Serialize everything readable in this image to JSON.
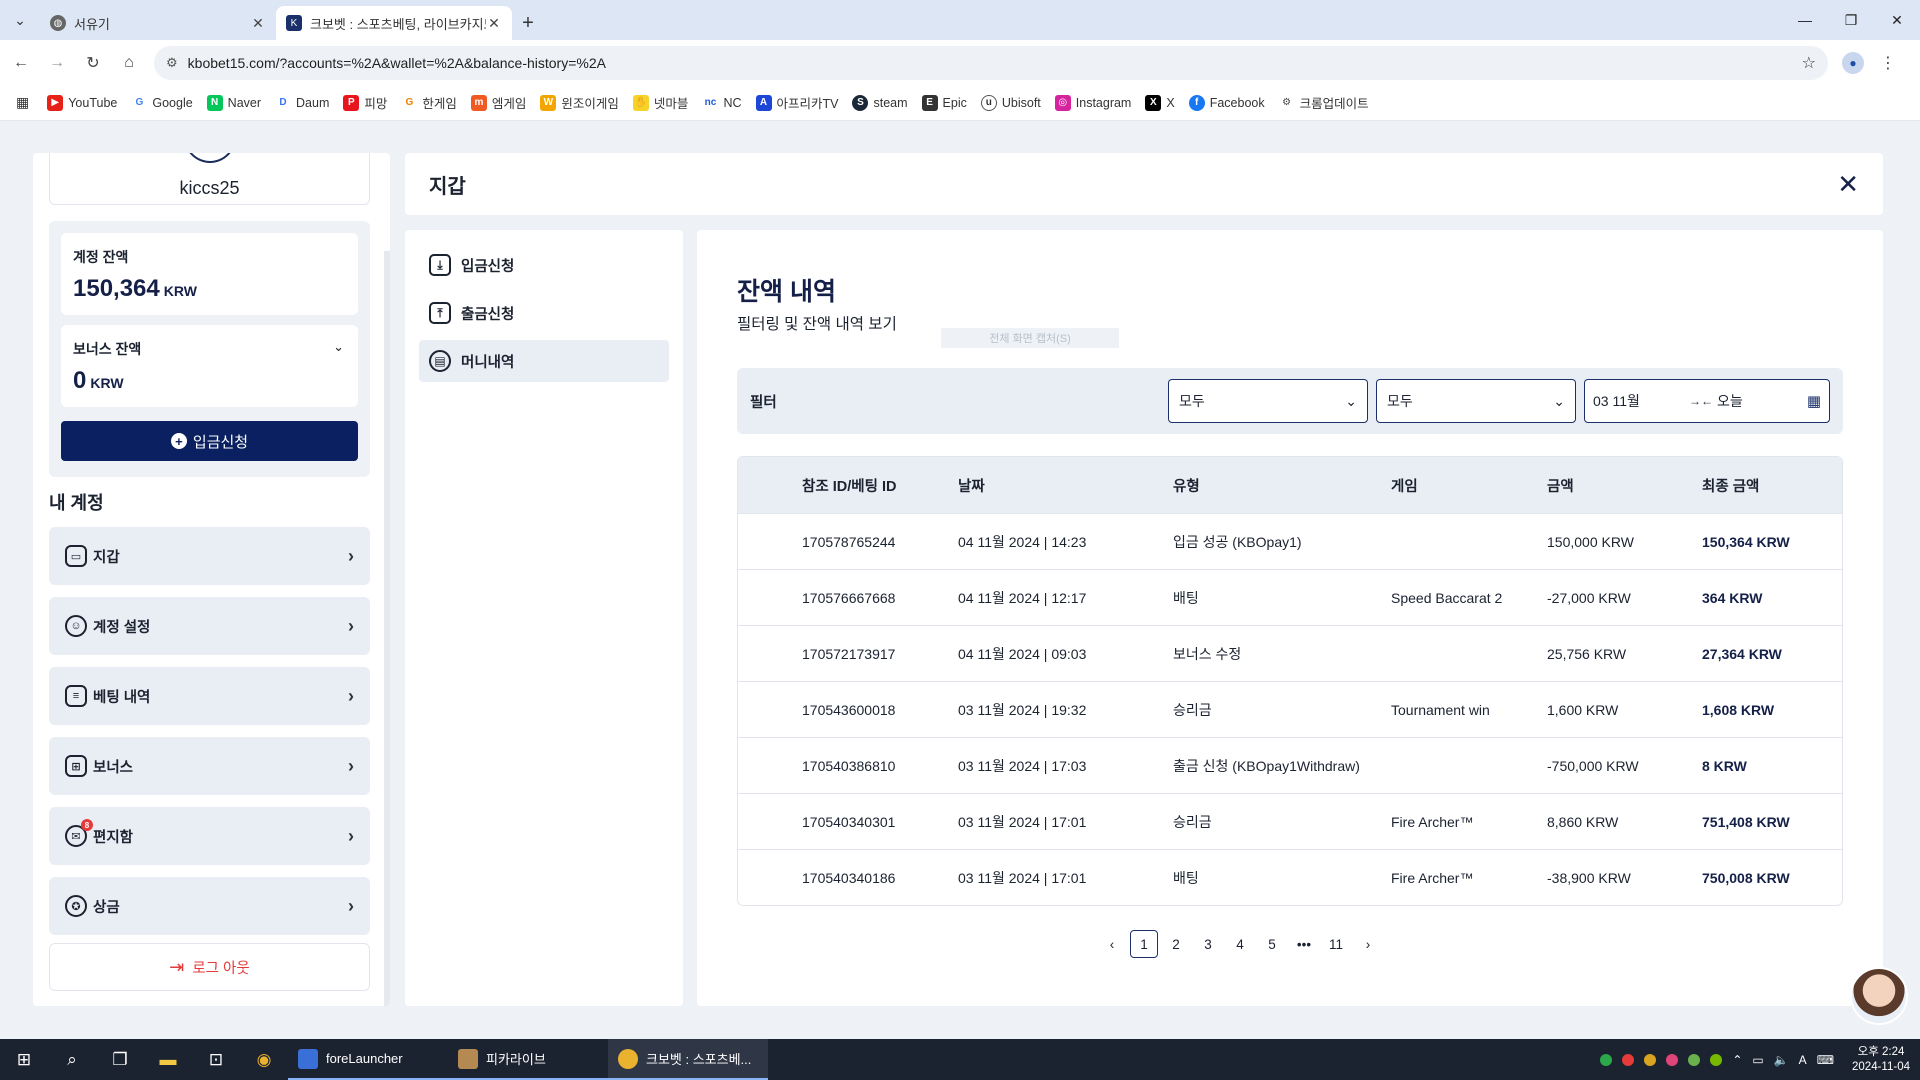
{
  "browser": {
    "tabs": [
      {
        "title": "서유기",
        "active": false
      },
      {
        "title": "크보벳 : 스포츠베팅, 라이브카지노",
        "active": true
      }
    ],
    "url": "kbobet15.com/?accounts=%2A&wallet=%2A&balance-history=%2A",
    "bookmarks": [
      "YouTube",
      "Google",
      "Naver",
      "Daum",
      "피망",
      "한게임",
      "엠게임",
      "윈조이게임",
      "넷마블",
      "NC",
      "아프리카TV",
      "steam",
      "Epic",
      "Ubisoft",
      "Instagram",
      "X",
      "Facebook",
      "크롬업데이트"
    ]
  },
  "sidebar": {
    "username": "kiccs25",
    "account_balance_label": "계정 잔액",
    "account_balance": "150,364",
    "bonus_balance_label": "보너스 잔액",
    "bonus_balance": "0",
    "currency": "KRW",
    "deposit_button": "입금신청",
    "my_account_title": "내 계정",
    "menu": [
      {
        "label": "지갑",
        "icon": "wallet-icon"
      },
      {
        "label": "계정 설정",
        "icon": "user-settings-icon"
      },
      {
        "label": "베팅 내역",
        "icon": "bet-history-icon"
      },
      {
        "label": "보너스",
        "icon": "gift-icon"
      },
      {
        "label": "편지함",
        "icon": "mailbox-icon",
        "badge": "8"
      },
      {
        "label": "상금",
        "icon": "prize-icon"
      }
    ],
    "logout": "로그 아웃"
  },
  "wallet": {
    "title": "지갑",
    "submenu": [
      {
        "label": "입금신청",
        "icon": "download-icon"
      },
      {
        "label": "출금신청",
        "icon": "upload-icon"
      },
      {
        "label": "머니내역",
        "icon": "document-icon"
      }
    ]
  },
  "balance_history": {
    "title": "잔액 내역",
    "subtitle": "필터링 및 잔액 내역 보기",
    "ghost_text": "전체 화면 캡처(S)",
    "filter_label": "필터",
    "filter_select_1": "모두",
    "filter_select_2": "모두",
    "date_from": "03 11월",
    "date_to": "오늘",
    "columns": [
      "참조 ID/베팅 ID",
      "날짜",
      "유형",
      "게임",
      "금액",
      "최종 금액"
    ],
    "rows": [
      [
        "170578765244",
        "04 11월 2024 | 14:23",
        "입금 성공 (KBOpay1)",
        "",
        "150,000 KRW",
        "150,364 KRW"
      ],
      [
        "170576667668",
        "04 11월 2024 | 12:17",
        "배팅",
        "Speed Baccarat 2",
        "-27,000 KRW",
        "364 KRW"
      ],
      [
        "170572173917",
        "04 11월 2024 | 09:03",
        "보너스 수정",
        "",
        "25,756 KRW",
        "27,364 KRW"
      ],
      [
        "170543600018",
        "03 11월 2024 | 19:32",
        "승리금",
        "Tournament win",
        "1,600 KRW",
        "1,608 KRW"
      ],
      [
        "170540386810",
        "03 11월 2024 | 17:03",
        "출금 신청 (KBOpay1Withdraw)",
        "",
        "-750,000 KRW",
        "8 KRW"
      ],
      [
        "170540340301",
        "03 11월 2024 | 17:01",
        "승리금",
        "Fire Archer™",
        "8,860 KRW",
        "751,408 KRW"
      ],
      [
        "170540340186",
        "03 11월 2024 | 17:01",
        "배팅",
        "Fire Archer™",
        "-38,900 KRW",
        "750,008 KRW"
      ]
    ],
    "pagination": [
      "1",
      "2",
      "3",
      "4",
      "5",
      "•••",
      "11"
    ],
    "current_page": "1"
  },
  "taskbar": {
    "apps": [
      "foreLauncher",
      "피카라이브",
      "크보벳 : 스포츠베..."
    ],
    "time": "오후 2:24",
    "date": "2024-11-04",
    "ime": "A"
  },
  "colors": {
    "navy": "#0b2060",
    "accent_border": "#1b2f6a",
    "panel_gray": "#e9eef5",
    "logout_red": "#e23b3b"
  }
}
